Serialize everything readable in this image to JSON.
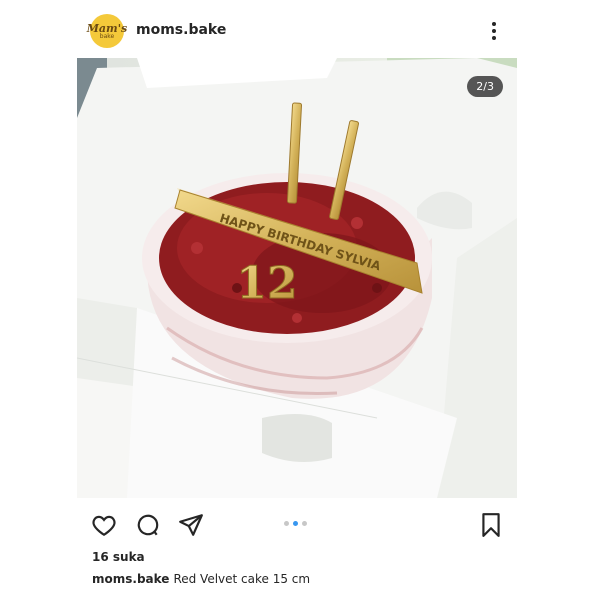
{
  "post": {
    "username": "moms.bake",
    "avatar": {
      "main": "Mam's",
      "sub": "bake"
    },
    "photo": {
      "counter": "2/3",
      "plaque_text": "HAPPY BIRTHDAY SYLVIA",
      "number_topper": "12"
    },
    "carousel": {
      "total": 3,
      "active_index": 1
    },
    "likes": "16 suka",
    "caption_user": "moms.bake",
    "caption_text": "Red Velvet cake 15 cm"
  },
  "icons": {
    "more": "more-vertical-icon",
    "like": "heart-icon",
    "comment": "comment-icon",
    "share": "send-icon",
    "save": "bookmark-icon"
  },
  "colors": {
    "accent": "#3897f0",
    "text": "#262626",
    "avatar_bg": "#f4c93a"
  }
}
